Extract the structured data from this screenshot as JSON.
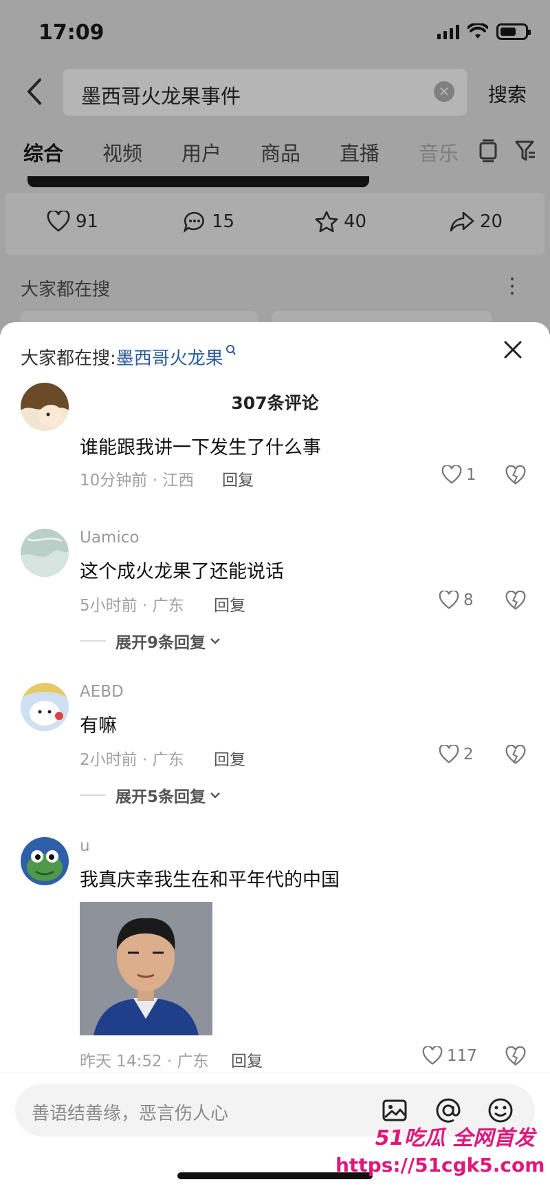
{
  "status_bar": {
    "time": "17:09"
  },
  "search": {
    "query": "墨西哥火龙果事件",
    "button_label": "搜索"
  },
  "tabs": [
    {
      "label": "综合"
    },
    {
      "label": "视频"
    },
    {
      "label": "用户"
    },
    {
      "label": "商品"
    },
    {
      "label": "直播"
    },
    {
      "label": "音乐"
    }
  ],
  "post_stats": {
    "likes": "91",
    "comments": "15",
    "favorites": "40",
    "shares": "20"
  },
  "bg_section": {
    "title": "大家都在搜"
  },
  "sheet": {
    "topic_prefix": "大家都在搜:",
    "topic_link": "墨西哥火龙果",
    "comment_count": "307条评论"
  },
  "comments": [
    {
      "user": "",
      "text": "谁能跟我讲一下发生了什么事",
      "meta": "10分钟前 · 江西",
      "reply": "回复",
      "likes": "1"
    },
    {
      "user": "Uamico",
      "text": "这个成火龙果了还能说话",
      "meta": "5小时前 · 广东",
      "reply": "回复",
      "likes": "8",
      "expand": "展开9条回复"
    },
    {
      "user": "AEBD",
      "text": "有嘛",
      "meta": "2小时前 · 广东",
      "reply": "回复",
      "likes": "2",
      "expand": "展开5条回复"
    },
    {
      "user": "u",
      "text": "我真庆幸我生在和平年代的中国",
      "meta": "昨天 14:52 · 广东",
      "reply": "回复",
      "likes": "117"
    }
  ],
  "input": {
    "placeholder": "善语结善缘，恶言伤人心"
  },
  "watermark": {
    "line1": "51吃瓜 全网首发",
    "line2": "https://51cgk5.com"
  },
  "colors": {
    "topic_link": "#2b5b9a",
    "watermark": "#e0177a"
  }
}
